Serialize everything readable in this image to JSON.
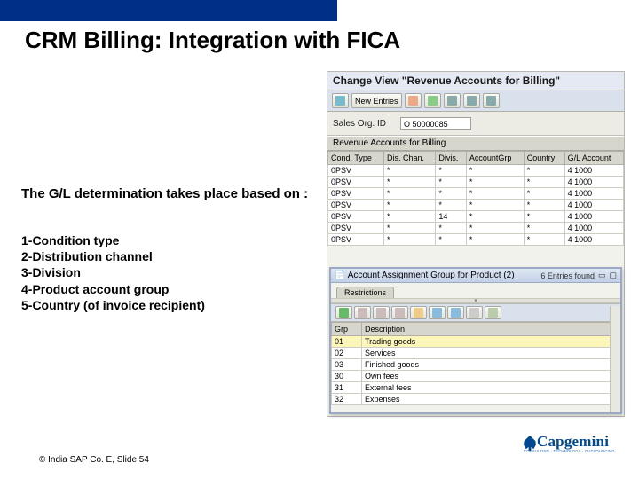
{
  "slide": {
    "title": "CRM Billing: Integration with FICA",
    "body_intro": "The G/L determination takes place based on :",
    "criteria": [
      "1-Condition type",
      "2-Distribution channel",
      "3-Division",
      "4-Product account group",
      "5-Country (of invoice recipient)"
    ],
    "footer": "© India SAP Co. E, Slide 54",
    "brand": {
      "name": "Capgemini",
      "tagline": "CONSULTING · TECHNOLOGY · OUTSOURCING"
    }
  },
  "sap": {
    "window_title": "Change View \"Revenue Accounts for Billing\"",
    "toolbar": {
      "new_entries": "New Entries",
      "icons": [
        "doc-new-icon",
        "copy-icon",
        "delete-icon",
        "select-all-icon",
        "deselect-icon",
        "columns-icon"
      ]
    },
    "form": {
      "sales_org_label": "Sales Org. ID",
      "sales_org_value": "O 50000085"
    },
    "group_header": "Revenue Accounts for Billing",
    "columns": [
      "Cond. Type",
      "Dis. Chan.",
      "Divis.",
      "AccountGrp",
      "Country",
      "G/L Account"
    ],
    "rows": [
      {
        "cond": "0PSV",
        "dc": "*",
        "div": "*",
        "ag": "*",
        "co": "*",
        "gl": "4 1000"
      },
      {
        "cond": "0PSV",
        "dc": "*",
        "div": "*",
        "ag": "*",
        "co": "*",
        "gl": "4 1000"
      },
      {
        "cond": "0PSV",
        "dc": "*",
        "div": "*",
        "ag": "*",
        "co": "*",
        "gl": "4 1000"
      },
      {
        "cond": "0PSV",
        "dc": "*",
        "div": "*",
        "ag": "*",
        "co": "*",
        "gl": "4 1000"
      },
      {
        "cond": "0PSV",
        "dc": "*",
        "div": "14",
        "ag": "*",
        "co": "*",
        "gl": "4 1000"
      },
      {
        "cond": "0PSV",
        "dc": "*",
        "div": "*",
        "ag": "*",
        "co": "*",
        "gl": "4 1000"
      },
      {
        "cond": "0PSV",
        "dc": "*",
        "div": "*",
        "ag": "*",
        "co": "*",
        "gl": "4 1000"
      }
    ],
    "popup": {
      "title_left": "Account Assignment Group for Product (2)",
      "title_right": "6 Entries found",
      "tab_label": "Restrictions",
      "toolbar_icons": [
        "check-icon",
        "filter-icon",
        "sort-icon",
        "sort-desc-icon",
        "sum-icon",
        "find-icon",
        "export-icon",
        "print-icon",
        "layout-icon"
      ],
      "columns": [
        "Grp",
        "Description"
      ],
      "rows": [
        {
          "grp": "01",
          "desc": "Trading goods",
          "hl": true
        },
        {
          "grp": "02",
          "desc": "Services"
        },
        {
          "grp": "03",
          "desc": "Finished goods"
        },
        {
          "grp": "30",
          "desc": "Own fees"
        },
        {
          "grp": "31",
          "desc": "External fees"
        },
        {
          "grp": "32",
          "desc": "Expenses"
        }
      ]
    }
  }
}
